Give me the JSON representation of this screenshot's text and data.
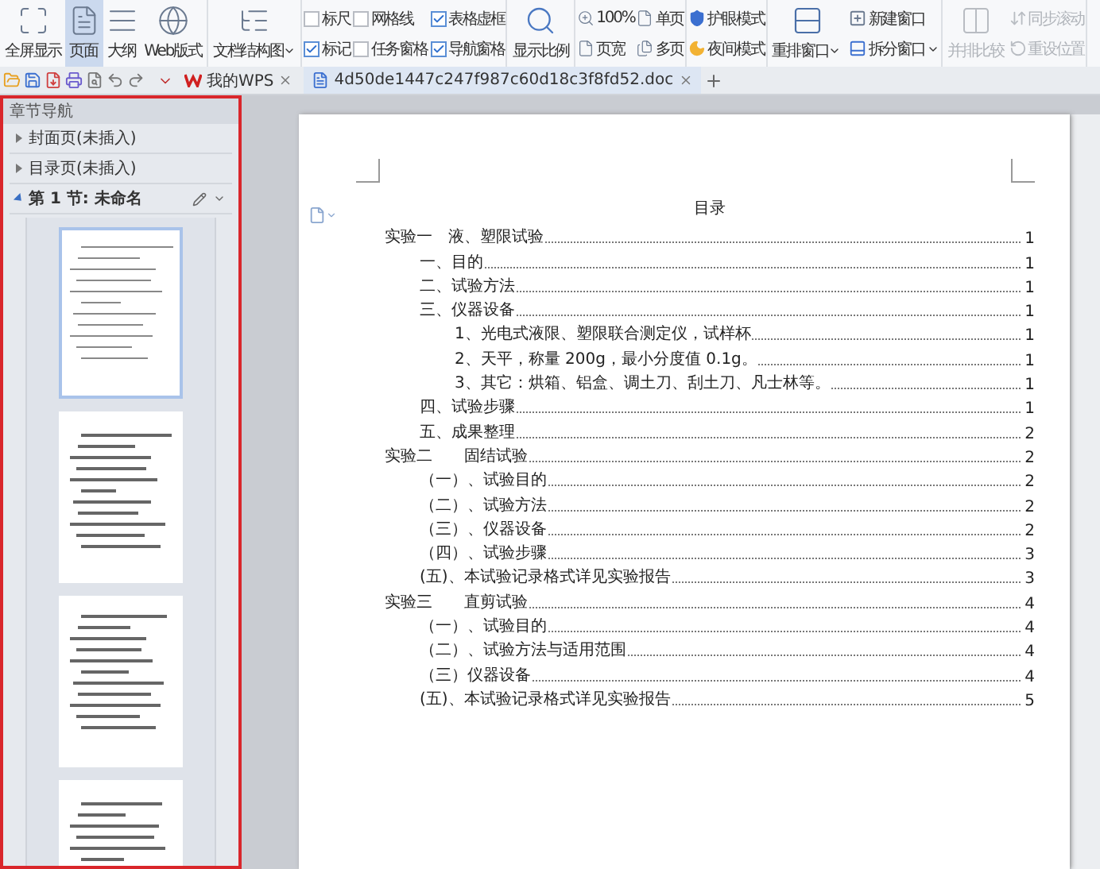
{
  "view_modes": [
    {
      "label": "全屏显示",
      "selected": false
    },
    {
      "label": "页面",
      "selected": true
    },
    {
      "label": "大纲",
      "selected": false
    },
    {
      "label": "Web版式",
      "selected": false
    }
  ],
  "doc_map_button": {
    "label": "文档结构图"
  },
  "show_options": [
    {
      "label": "标尺",
      "checked": false
    },
    {
      "label": "标记",
      "checked": true
    },
    {
      "label": "网格线",
      "checked": false
    },
    {
      "label": "任务窗格",
      "checked": false
    },
    {
      "label": "表格虚框",
      "checked": true
    },
    {
      "label": "导航窗格",
      "checked": true
    }
  ],
  "zoom_button": {
    "label": "显示比例"
  },
  "zoom_options": [
    {
      "label": "100%"
    },
    {
      "label": "页宽"
    },
    {
      "label": "单页"
    },
    {
      "label": "多页"
    }
  ],
  "eye_modes": [
    {
      "label": "护眼模式"
    },
    {
      "label": "夜间模式"
    }
  ],
  "window_tools": {
    "rearrange": "重排窗口",
    "new_window": "新建窗口",
    "split": "拆分窗口"
  },
  "compare_tools": {
    "disabled": true,
    "compare": "并排比较",
    "sync_scroll": "同步滚动",
    "reset_position": "重设位置"
  },
  "tabs": [
    {
      "label": "我的WPS",
      "selected": false
    },
    {
      "label": "4d50de1447c247f987c60d18c3f8fd52.doc",
      "selected": true
    }
  ],
  "nav_pane": {
    "title": "章节导航",
    "sections": [
      {
        "label": "封面页(未插入)",
        "expanded": false
      },
      {
        "label": "目录页(未插入)",
        "expanded": false
      },
      {
        "label": "第 1 节: 未命名",
        "expanded": true
      }
    ],
    "pages": [
      {
        "selected": true
      },
      {
        "selected": false
      },
      {
        "selected": false
      },
      {
        "selected": false
      }
    ]
  },
  "document": {
    "title": "目录",
    "toc": [
      {
        "text": "实验一　液、塑限试验",
        "page": "1",
        "children": [
          {
            "text": "一、目的",
            "page": "1"
          },
          {
            "text": "二、试验方法",
            "page": "1"
          },
          {
            "text": "三、仪器设备",
            "page": "1",
            "children": [
              {
                "text": "1、光电式液限、塑限联合测定仪，试样杯",
                "page": "1"
              },
              {
                "text": "2、天平，称量 200g，最小分度值 0.1g。",
                "page": "1"
              },
              {
                "text": "3、其它：烘箱、铝盒、调土刀、刮土刀、凡士林等。",
                "page": "1"
              }
            ]
          },
          {
            "text": "四、试验步骤",
            "page": "1"
          },
          {
            "text": "五、成果整理",
            "page": "2"
          }
        ]
      },
      {
        "text": "实验二　　固结试验",
        "page": "2",
        "children": [
          {
            "text": "（一）、试验目的",
            "page": "2"
          },
          {
            "text": "（二）、试验方法",
            "page": "2"
          },
          {
            "text": "（三）、仪器设备",
            "page": "2"
          },
          {
            "text": "（四）、试验步骤",
            "page": "3"
          },
          {
            "text": "(五)、本试验记录格式详见实验报告",
            "page": "3"
          }
        ]
      },
      {
        "text": "实验三　　直剪试验",
        "page": "4",
        "children": [
          {
            "text": "（一）、试验目的",
            "page": "4"
          },
          {
            "text": "（二）、试验方法与适用范围",
            "page": "4"
          },
          {
            "text": "（三）仪器设备",
            "page": "4"
          },
          {
            "text": "(五)、本试验记录格式详见实验报告",
            "page": "5"
          }
        ]
      }
    ]
  }
}
